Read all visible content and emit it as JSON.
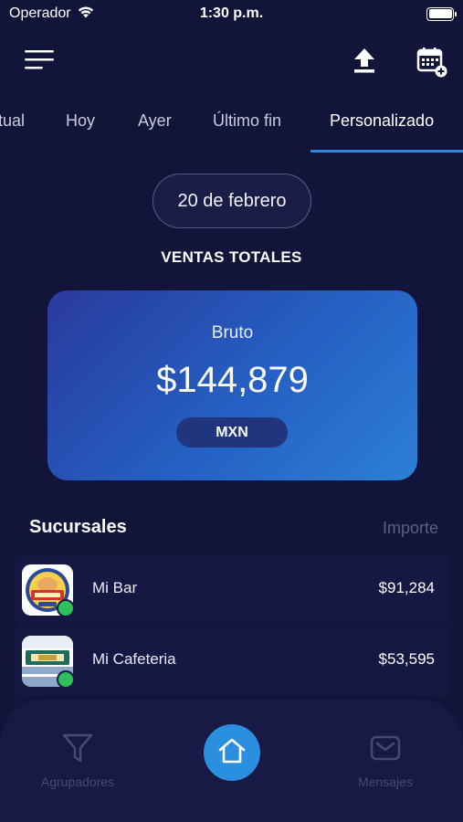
{
  "status_bar": {
    "carrier": "Operador",
    "time": "1:30 p.m."
  },
  "header": {
    "menu_icon": "hamburger-menu-icon",
    "upload_icon": "upload-icon",
    "calendar_icon": "calendar-add-icon"
  },
  "tabs": [
    {
      "label": "tual"
    },
    {
      "label": "Hoy"
    },
    {
      "label": "Ayer"
    },
    {
      "label": "Último fin"
    },
    {
      "label": "Personalizado",
      "active": true
    }
  ],
  "date_selector": {
    "label": "20 de febrero"
  },
  "sales_section": {
    "title": "VENTAS TOTALES"
  },
  "summary_card": {
    "label": "Bruto",
    "amount": "$144,879",
    "currency": "MXN"
  },
  "branches": {
    "title": "Sucursales",
    "column": "Importe",
    "rows": [
      {
        "name": "Mi Bar",
        "value": "$91,284",
        "status": "online"
      },
      {
        "name": "Mi Cafeteria",
        "value": "$53,595",
        "status": "online"
      }
    ]
  },
  "bottom_nav": {
    "left": {
      "label": "Agrupadores",
      "icon": "filter-icon"
    },
    "center": {
      "icon": "home-icon"
    },
    "right": {
      "label": "Mensajes",
      "icon": "mail-icon"
    }
  },
  "colors": {
    "background": "#131439",
    "accent": "#2b8fe0",
    "status_online": "#2fbf5b"
  }
}
